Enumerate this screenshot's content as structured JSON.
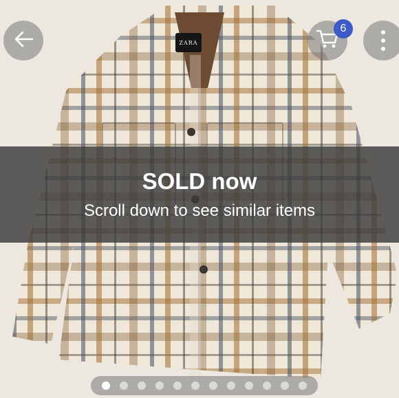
{
  "top_bar": {
    "back_icon": "arrow-left-icon",
    "cart_icon": "shopping-cart-icon",
    "cart_count": "6",
    "more_icon": "more-vertical-icon"
  },
  "product_image": {
    "brand_label": "ZARA"
  },
  "sold_overlay": {
    "title": "SOLD now",
    "subtitle": "Scroll down to see similar items"
  },
  "pager": {
    "total": 12,
    "active_index": 0
  },
  "colors": {
    "overlay": "#3c3c3c",
    "badge": "#3d5ac9"
  }
}
